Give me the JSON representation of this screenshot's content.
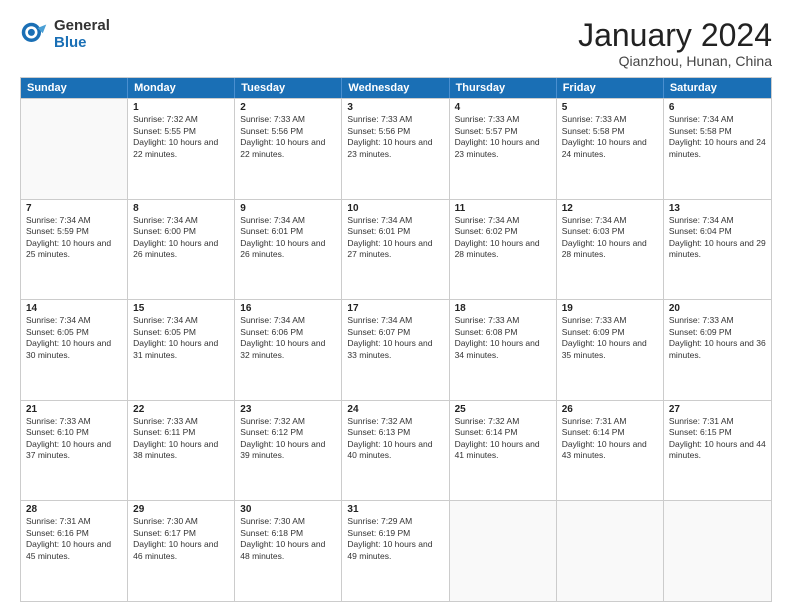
{
  "header": {
    "logo_general": "General",
    "logo_blue": "Blue",
    "title": "January 2024",
    "subtitle": "Qianzhou, Hunan, China"
  },
  "days_of_week": [
    "Sunday",
    "Monday",
    "Tuesday",
    "Wednesday",
    "Thursday",
    "Friday",
    "Saturday"
  ],
  "weeks": [
    [
      {
        "day": "",
        "empty": true
      },
      {
        "day": "1",
        "sunrise": "Sunrise: 7:32 AM",
        "sunset": "Sunset: 5:55 PM",
        "daylight": "Daylight: 10 hours and 22 minutes."
      },
      {
        "day": "2",
        "sunrise": "Sunrise: 7:33 AM",
        "sunset": "Sunset: 5:56 PM",
        "daylight": "Daylight: 10 hours and 22 minutes."
      },
      {
        "day": "3",
        "sunrise": "Sunrise: 7:33 AM",
        "sunset": "Sunset: 5:56 PM",
        "daylight": "Daylight: 10 hours and 23 minutes."
      },
      {
        "day": "4",
        "sunrise": "Sunrise: 7:33 AM",
        "sunset": "Sunset: 5:57 PM",
        "daylight": "Daylight: 10 hours and 23 minutes."
      },
      {
        "day": "5",
        "sunrise": "Sunrise: 7:33 AM",
        "sunset": "Sunset: 5:58 PM",
        "daylight": "Daylight: 10 hours and 24 minutes."
      },
      {
        "day": "6",
        "sunrise": "Sunrise: 7:34 AM",
        "sunset": "Sunset: 5:58 PM",
        "daylight": "Daylight: 10 hours and 24 minutes."
      }
    ],
    [
      {
        "day": "7",
        "sunrise": "Sunrise: 7:34 AM",
        "sunset": "Sunset: 5:59 PM",
        "daylight": "Daylight: 10 hours and 25 minutes."
      },
      {
        "day": "8",
        "sunrise": "Sunrise: 7:34 AM",
        "sunset": "Sunset: 6:00 PM",
        "daylight": "Daylight: 10 hours and 26 minutes."
      },
      {
        "day": "9",
        "sunrise": "Sunrise: 7:34 AM",
        "sunset": "Sunset: 6:01 PM",
        "daylight": "Daylight: 10 hours and 26 minutes."
      },
      {
        "day": "10",
        "sunrise": "Sunrise: 7:34 AM",
        "sunset": "Sunset: 6:01 PM",
        "daylight": "Daylight: 10 hours and 27 minutes."
      },
      {
        "day": "11",
        "sunrise": "Sunrise: 7:34 AM",
        "sunset": "Sunset: 6:02 PM",
        "daylight": "Daylight: 10 hours and 28 minutes."
      },
      {
        "day": "12",
        "sunrise": "Sunrise: 7:34 AM",
        "sunset": "Sunset: 6:03 PM",
        "daylight": "Daylight: 10 hours and 28 minutes."
      },
      {
        "day": "13",
        "sunrise": "Sunrise: 7:34 AM",
        "sunset": "Sunset: 6:04 PM",
        "daylight": "Daylight: 10 hours and 29 minutes."
      }
    ],
    [
      {
        "day": "14",
        "sunrise": "Sunrise: 7:34 AM",
        "sunset": "Sunset: 6:05 PM",
        "daylight": "Daylight: 10 hours and 30 minutes."
      },
      {
        "day": "15",
        "sunrise": "Sunrise: 7:34 AM",
        "sunset": "Sunset: 6:05 PM",
        "daylight": "Daylight: 10 hours and 31 minutes."
      },
      {
        "day": "16",
        "sunrise": "Sunrise: 7:34 AM",
        "sunset": "Sunset: 6:06 PM",
        "daylight": "Daylight: 10 hours and 32 minutes."
      },
      {
        "day": "17",
        "sunrise": "Sunrise: 7:34 AM",
        "sunset": "Sunset: 6:07 PM",
        "daylight": "Daylight: 10 hours and 33 minutes."
      },
      {
        "day": "18",
        "sunrise": "Sunrise: 7:33 AM",
        "sunset": "Sunset: 6:08 PM",
        "daylight": "Daylight: 10 hours and 34 minutes."
      },
      {
        "day": "19",
        "sunrise": "Sunrise: 7:33 AM",
        "sunset": "Sunset: 6:09 PM",
        "daylight": "Daylight: 10 hours and 35 minutes."
      },
      {
        "day": "20",
        "sunrise": "Sunrise: 7:33 AM",
        "sunset": "Sunset: 6:09 PM",
        "daylight": "Daylight: 10 hours and 36 minutes."
      }
    ],
    [
      {
        "day": "21",
        "sunrise": "Sunrise: 7:33 AM",
        "sunset": "Sunset: 6:10 PM",
        "daylight": "Daylight: 10 hours and 37 minutes."
      },
      {
        "day": "22",
        "sunrise": "Sunrise: 7:33 AM",
        "sunset": "Sunset: 6:11 PM",
        "daylight": "Daylight: 10 hours and 38 minutes."
      },
      {
        "day": "23",
        "sunrise": "Sunrise: 7:32 AM",
        "sunset": "Sunset: 6:12 PM",
        "daylight": "Daylight: 10 hours and 39 minutes."
      },
      {
        "day": "24",
        "sunrise": "Sunrise: 7:32 AM",
        "sunset": "Sunset: 6:13 PM",
        "daylight": "Daylight: 10 hours and 40 minutes."
      },
      {
        "day": "25",
        "sunrise": "Sunrise: 7:32 AM",
        "sunset": "Sunset: 6:14 PM",
        "daylight": "Daylight: 10 hours and 41 minutes."
      },
      {
        "day": "26",
        "sunrise": "Sunrise: 7:31 AM",
        "sunset": "Sunset: 6:14 PM",
        "daylight": "Daylight: 10 hours and 43 minutes."
      },
      {
        "day": "27",
        "sunrise": "Sunrise: 7:31 AM",
        "sunset": "Sunset: 6:15 PM",
        "daylight": "Daylight: 10 hours and 44 minutes."
      }
    ],
    [
      {
        "day": "28",
        "sunrise": "Sunrise: 7:31 AM",
        "sunset": "Sunset: 6:16 PM",
        "daylight": "Daylight: 10 hours and 45 minutes."
      },
      {
        "day": "29",
        "sunrise": "Sunrise: 7:30 AM",
        "sunset": "Sunset: 6:17 PM",
        "daylight": "Daylight: 10 hours and 46 minutes."
      },
      {
        "day": "30",
        "sunrise": "Sunrise: 7:30 AM",
        "sunset": "Sunset: 6:18 PM",
        "daylight": "Daylight: 10 hours and 48 minutes."
      },
      {
        "day": "31",
        "sunrise": "Sunrise: 7:29 AM",
        "sunset": "Sunset: 6:19 PM",
        "daylight": "Daylight: 10 hours and 49 minutes."
      },
      {
        "day": "",
        "empty": true
      },
      {
        "day": "",
        "empty": true
      },
      {
        "day": "",
        "empty": true
      }
    ]
  ]
}
